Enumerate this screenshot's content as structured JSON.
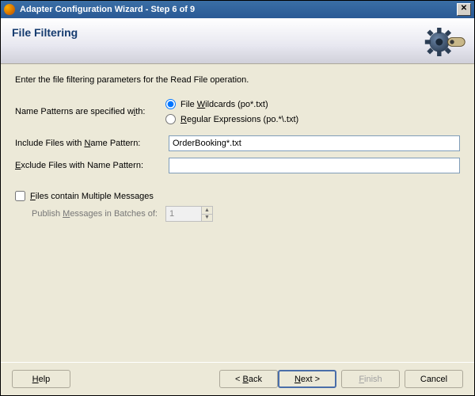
{
  "window": {
    "title": "Adapter Configuration Wizard - Step 6 of 9"
  },
  "header": {
    "title": "File Filtering"
  },
  "content": {
    "instruction": "Enter the file filtering parameters for the Read File operation.",
    "patternLabel_pre": "Name Patterns are specified w",
    "patternLabel_m": "i",
    "patternLabel_post": "th:",
    "radioWildcards_pre": "File ",
    "radioWildcards_m": "W",
    "radioWildcards_post": "ildcards (po*.txt)",
    "radioRegex_m": "R",
    "radioRegex_post": "egular Expressions (po.*\\.txt)",
    "includeLabel_pre": "Include Files with ",
    "includeLabel_m": "N",
    "includeLabel_post": "ame Pattern:",
    "includeValue": "OrderBooking*.txt",
    "excludeLabel_m": "E",
    "excludeLabel_post": "xclude Files with Name Pattern:",
    "excludeValue": "",
    "multiCheck_m": "F",
    "multiCheck_post": "iles contain Multiple Messages",
    "batchLabel_pre": "Publish ",
    "batchLabel_m": "M",
    "batchLabel_post": "essages in Batches of:",
    "batchValue": "1"
  },
  "footer": {
    "help_m": "H",
    "help_post": "elp",
    "back_pre": "< ",
    "back_m": "B",
    "back_post": "ack",
    "next_m": "N",
    "next_post": "ext >",
    "finish_m": "F",
    "finish_post": "inish",
    "cancel": "Cancel"
  }
}
